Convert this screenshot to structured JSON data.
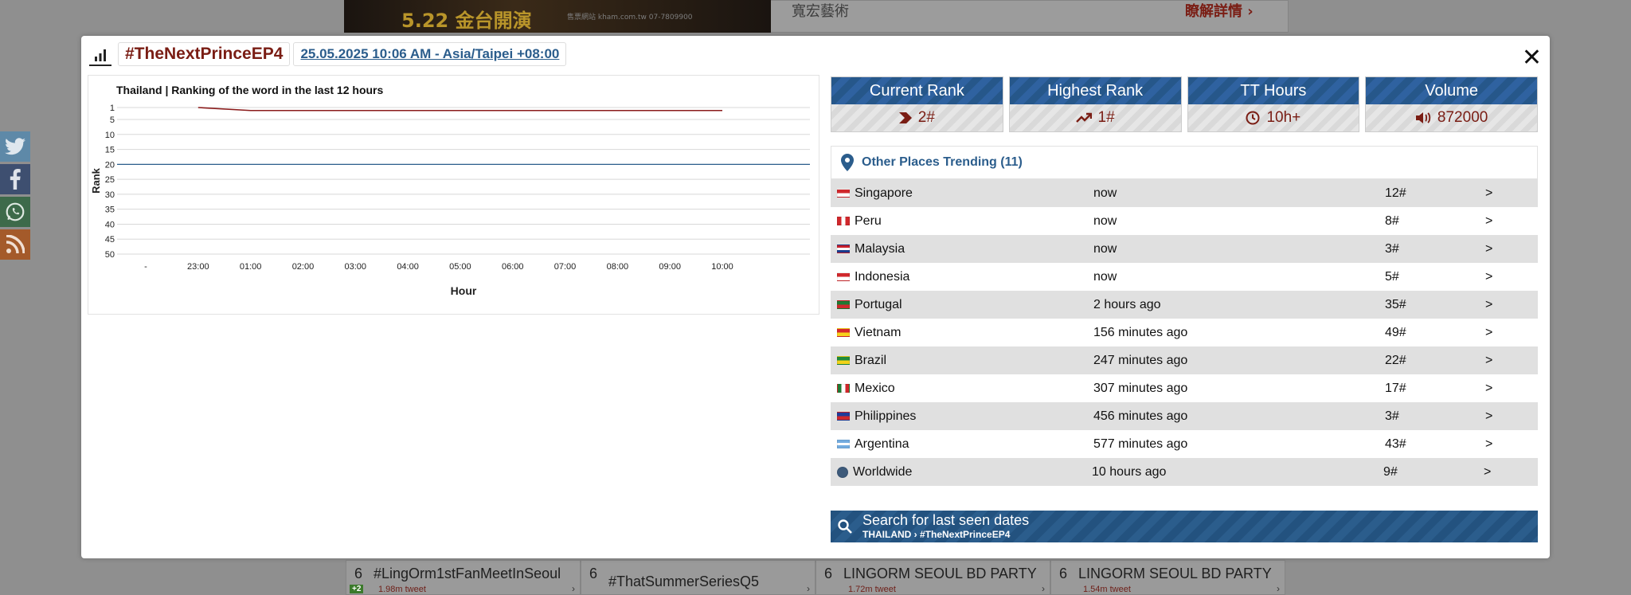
{
  "background": {
    "ad_text": "5.22 金台開演",
    "ad_sub": "售票網站 kham.com.tw 07-7809900",
    "link_text": "寬宏藝術",
    "cta_text": "瞭解詳情",
    "cards": [
      {
        "num": "6",
        "title": "#LingOrm1stFanMeetInSeoul",
        "sub": "1.98m tweet",
        "badge": "+2"
      },
      {
        "num": "6",
        "title": "#ThatSummerSeriesQ5",
        "sub": "",
        "badge": ""
      },
      {
        "num": "6",
        "title": "LINGORM SEOUL BD PARTY",
        "sub": "1.72m tweet",
        "badge": ""
      },
      {
        "num": "6",
        "title": "LINGORM SEOUL BD PARTY",
        "sub": "1.54m tweet",
        "badge": ""
      }
    ]
  },
  "modal": {
    "hashtag": "#TheNextPrinceEP4",
    "date": "25.05.2025 10:06 AM - Asia/Taipei +08:00",
    "close": "✕"
  },
  "stats": [
    {
      "label": "Current Rank",
      "icon": "chevron-right-icon",
      "value": "2#"
    },
    {
      "label": "Highest Rank",
      "icon": "trending-up-icon",
      "value": "1#"
    },
    {
      "label": "TT Hours",
      "icon": "clock-icon",
      "value": "10h+"
    },
    {
      "label": "Volume",
      "icon": "volume-icon",
      "value": "872000"
    }
  ],
  "places": {
    "title": "Other Places Trending (11)",
    "rows": [
      {
        "country": "Singapore",
        "when": "now",
        "rank": "12#",
        "go": ">",
        "flag": [
          "#d0282c",
          "#ffffff"
        ]
      },
      {
        "country": "Peru",
        "when": "now",
        "rank": "8#",
        "go": ">",
        "flag": [
          "#d0282c",
          "#ffffff",
          "#d0282c"
        ]
      },
      {
        "country": "Malaysia",
        "when": "now",
        "rank": "3#",
        "go": ">",
        "flag": [
          "#c8202c",
          "#ffffff",
          "#1b3a8c"
        ]
      },
      {
        "country": "Indonesia",
        "when": "now",
        "rank": "5#",
        "go": ">",
        "flag": [
          "#d0282c",
          "#ffffff"
        ]
      },
      {
        "country": "Portugal",
        "when": "2 hours ago",
        "rank": "35#",
        "go": ">",
        "flag": [
          "#1f7a33",
          "#d0282c"
        ]
      },
      {
        "country": "Vietnam",
        "when": "156 minutes ago",
        "rank": "49#",
        "go": ">",
        "flag": [
          "#d8282c",
          "#f7d21c"
        ]
      },
      {
        "country": "Brazil",
        "when": "247 minutes ago",
        "rank": "22#",
        "go": ">",
        "flag": [
          "#1f8a3a",
          "#f1d21a"
        ]
      },
      {
        "country": "Mexico",
        "when": "307 minutes ago",
        "rank": "17#",
        "go": ">",
        "flag": [
          "#1f7a33",
          "#ffffff",
          "#d0282c"
        ]
      },
      {
        "country": "Philippines",
        "when": "456 minutes ago",
        "rank": "3#",
        "go": ">",
        "flag": [
          "#1f3b9a",
          "#d0282c"
        ]
      },
      {
        "country": "Argentina",
        "when": "577 minutes ago",
        "rank": "43#",
        "go": ">",
        "flag": [
          "#74acdf",
          "#ffffff",
          "#74acdf"
        ]
      },
      {
        "country": "Worldwide",
        "when": "10 hours ago",
        "rank": "9#",
        "go": ">",
        "flag": [
          "#3d5a7a"
        ]
      }
    ]
  },
  "search": {
    "label": "Search for last seen dates",
    "crumb": "THAILAND › #TheNextPrinceEP4"
  },
  "chart_data": {
    "type": "line",
    "title": "Thailand | Ranking of the word in the last 12 hours",
    "xlabel": "Hour",
    "ylabel": "Rank",
    "categories": [
      "-",
      "23:00",
      "01:00",
      "02:00",
      "03:00",
      "04:00",
      "05:00",
      "06:00",
      "07:00",
      "08:00",
      "09:00",
      "10:00"
    ],
    "yticks": [
      1,
      5,
      10,
      15,
      20,
      25,
      30,
      35,
      40,
      45,
      50
    ],
    "ylim": [
      1,
      50
    ],
    "y_inverted": true,
    "grid": true,
    "series": [
      {
        "values": [
          null,
          1,
          2,
          2,
          2,
          2,
          2,
          2,
          2,
          2,
          2,
          2
        ],
        "color": "#8b1c1c"
      }
    ],
    "reference_line": {
      "y": 20,
      "color": "#2b5d8c"
    }
  }
}
